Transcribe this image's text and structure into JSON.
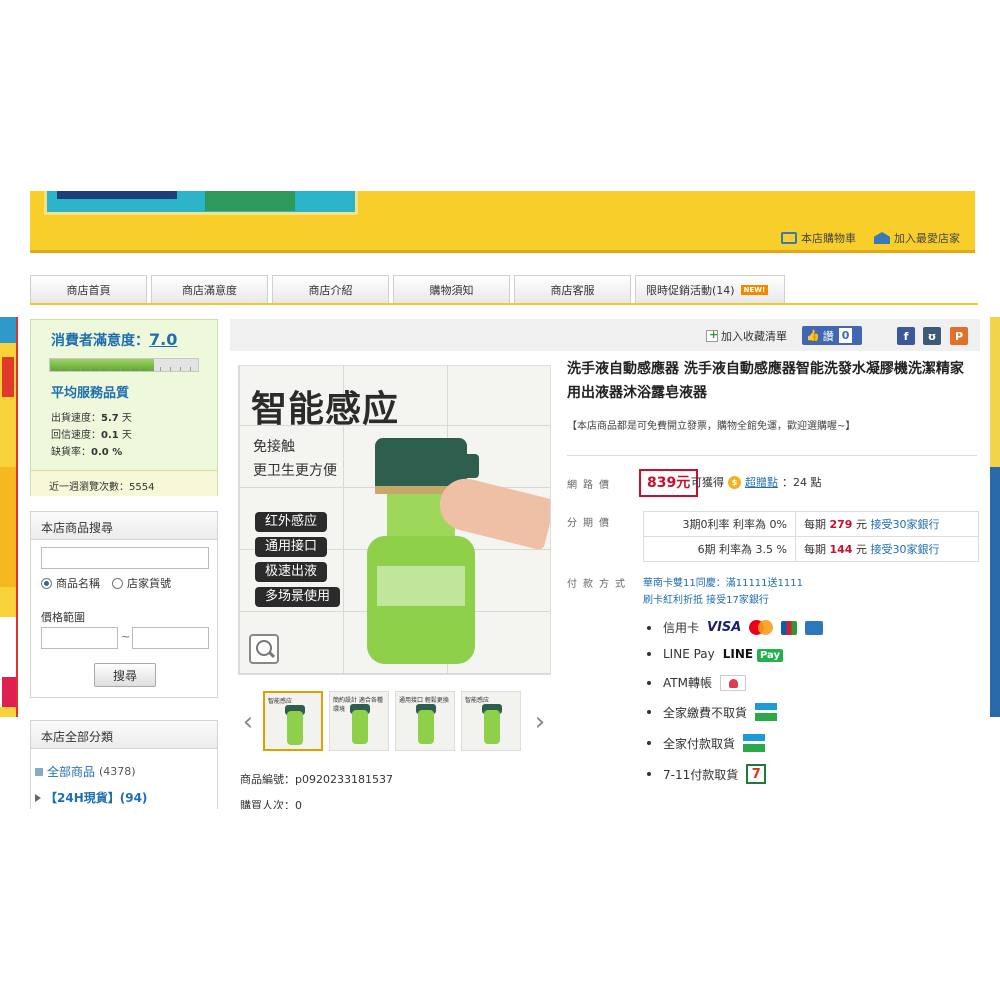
{
  "header": {
    "cart_link": "本店購物車",
    "favorite_store_link": "加入最愛店家"
  },
  "nav": {
    "tabs": [
      "商店首頁",
      "商店滿意度",
      "商店介紹",
      "購物須知",
      "商店客服",
      "限時促銷活動(14)"
    ],
    "new_badge": "NEW!"
  },
  "rating": {
    "label": "消費者滿意度：",
    "score": "7.0",
    "score_fraction": 0.7,
    "service_title": "平均服務品質",
    "ship_label": "出貨速度：",
    "ship_value": "5.7",
    "ship_unit": "天",
    "reply_label": "回信速度：",
    "reply_value": "0.1",
    "reply_unit": "天",
    "stockout_label": "缺貨率：",
    "stockout_value": "0.0 %",
    "weekly_visits": "近一週瀏覽次數：5554"
  },
  "search": {
    "title": "本店商品搜尋",
    "opt_name": "商品名稱",
    "opt_sku": "店家貨號",
    "price_range": "價格範圍",
    "tilde": "~",
    "button": "搜尋"
  },
  "categories": {
    "title": "本店全部分類",
    "all_label": "全部商品",
    "all_count": "(4378)",
    "hot_label": "【24H現貨】(94)"
  },
  "toolbar": {
    "add_favorite": "加入收藏清單",
    "like": "讚",
    "like_count": "0"
  },
  "product_image": {
    "title": "智能感应",
    "line1": "免接触",
    "line2": "更卫生更方便",
    "pills": [
      "红外感应",
      "通用接口",
      "极速出液",
      "多场景使用"
    ]
  },
  "thumbnails": {
    "captions": [
      "智能感应",
      "簡約設計 適合各種環境",
      "通用接口 輕鬆更換",
      "智能感应"
    ]
  },
  "product": {
    "title": "洗手液自動感應器 洗手液自動感應器智能洗發水凝膠機洗潔精家用出液器沐浴露皂液器",
    "notice": "【本店商品都是可免費開立發票，購物全館免運，歡迎選購喔~】",
    "code": "商品編號：p0920233181537",
    "purchase_partial": "購買人次：0"
  },
  "pricing": {
    "price_label": "網路價",
    "price": "839元",
    "earn_prefix": "可獲得",
    "bonus_link": "超贈點",
    "bonus_value": "：24 點",
    "installment_label": "分期價",
    "installments": [
      {
        "plan": "3期0利率 利率為 0%",
        "prefix": "每期",
        "amount": "279",
        "suffix": "元",
        "bank": "接受30家銀行"
      },
      {
        "plan": "6期 利率為 3.5 %",
        "prefix": "每期",
        "amount": "144",
        "suffix": "元",
        "bank": "接受30家銀行"
      }
    ]
  },
  "payment": {
    "label": "付款方式",
    "promo_line1": "華南卡雙11同慶：滿11111送1111",
    "promo_line2": "刷卡紅利折抵 接受17家銀行",
    "methods": [
      "信用卡",
      "LINE Pay",
      "ATM轉帳",
      "全家繳費不取貨",
      "全家付款取貨",
      "7-11付款取貨"
    ],
    "visa": "VISA",
    "line_logo": "LINE",
    "line_pay_badge": "Pay",
    "seven_eleven": "7"
  },
  "colors": {
    "banner_yellow": "#f8cf2a",
    "link_blue": "#1f6fb0",
    "price_red": "#c8102e",
    "facebook_blue": "#4267b2"
  }
}
